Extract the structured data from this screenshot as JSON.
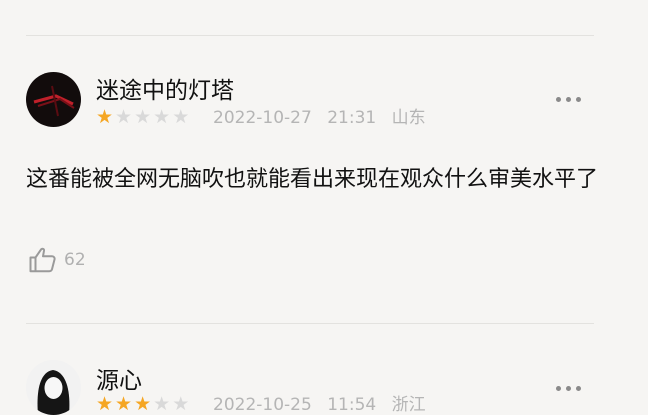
{
  "reviews": [
    {
      "username": "迷途中的灯塔",
      "rating": 1,
      "max_rating": 5,
      "date": "2022-10-27",
      "time": "21:31",
      "location": "山东",
      "content": "这番能被全网无脑吹也就能看出来现在观众什么审美水平了",
      "like_count": "62",
      "more_icon": "more-dots-icon",
      "like_icon": "thumbs-up-icon"
    },
    {
      "username": "源心",
      "rating": 3,
      "max_rating": 5,
      "date": "2022-10-25",
      "time": "11:54",
      "location": "浙江",
      "more_icon": "more-dots-icon"
    }
  ],
  "colors": {
    "star_on": "#f5a623",
    "star_off": "#d9d9d9",
    "meta": "#b5b5b5"
  }
}
